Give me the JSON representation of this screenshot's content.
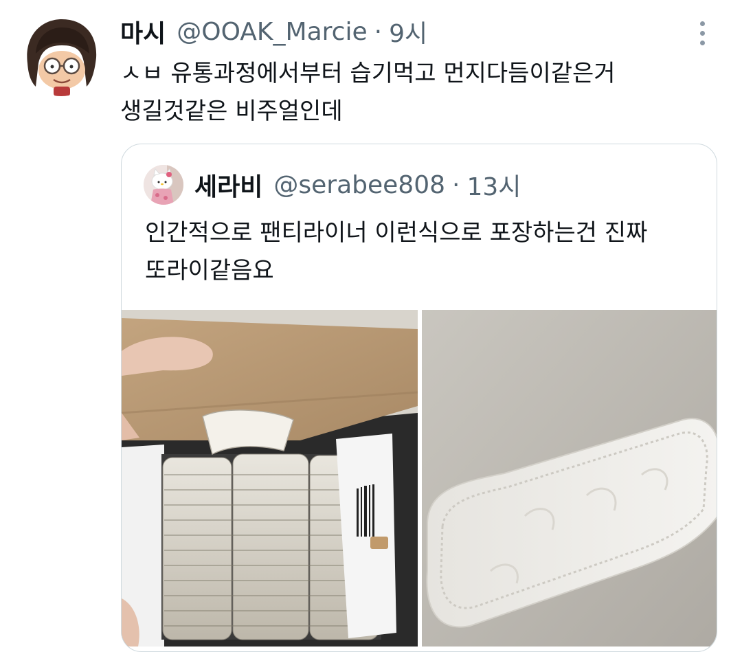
{
  "tweet": {
    "author_name": "마시",
    "author_handle": "@OOAK_Marcie",
    "separator": "·",
    "timestamp": "9시",
    "text_lines": [
      "ㅅㅂ 유통과정에서부터 습기먹고 먼지다듬이같은거",
      "생길것같은 비주얼인데"
    ],
    "avatar_icon": "cartoon-girl-glasses-avatar",
    "more_icon": "more-options-icon"
  },
  "quote": {
    "author_name": "세라비",
    "author_handle": "@serabee808",
    "separator": "·",
    "timestamp": "13시",
    "text_lines": [
      "인간적으로 팬티라이너 이런식으로 포장하는건 진짜",
      "또라이같음요"
    ],
    "avatar_icon": "hello-kitty-avatar",
    "images": [
      {
        "description_icon": "pantyliner-box-photo"
      },
      {
        "description_icon": "single-pantyliner-photo"
      }
    ]
  },
  "colors": {
    "text": "#0f1419",
    "secondary": "#536471",
    "border": "#cfd9de"
  }
}
